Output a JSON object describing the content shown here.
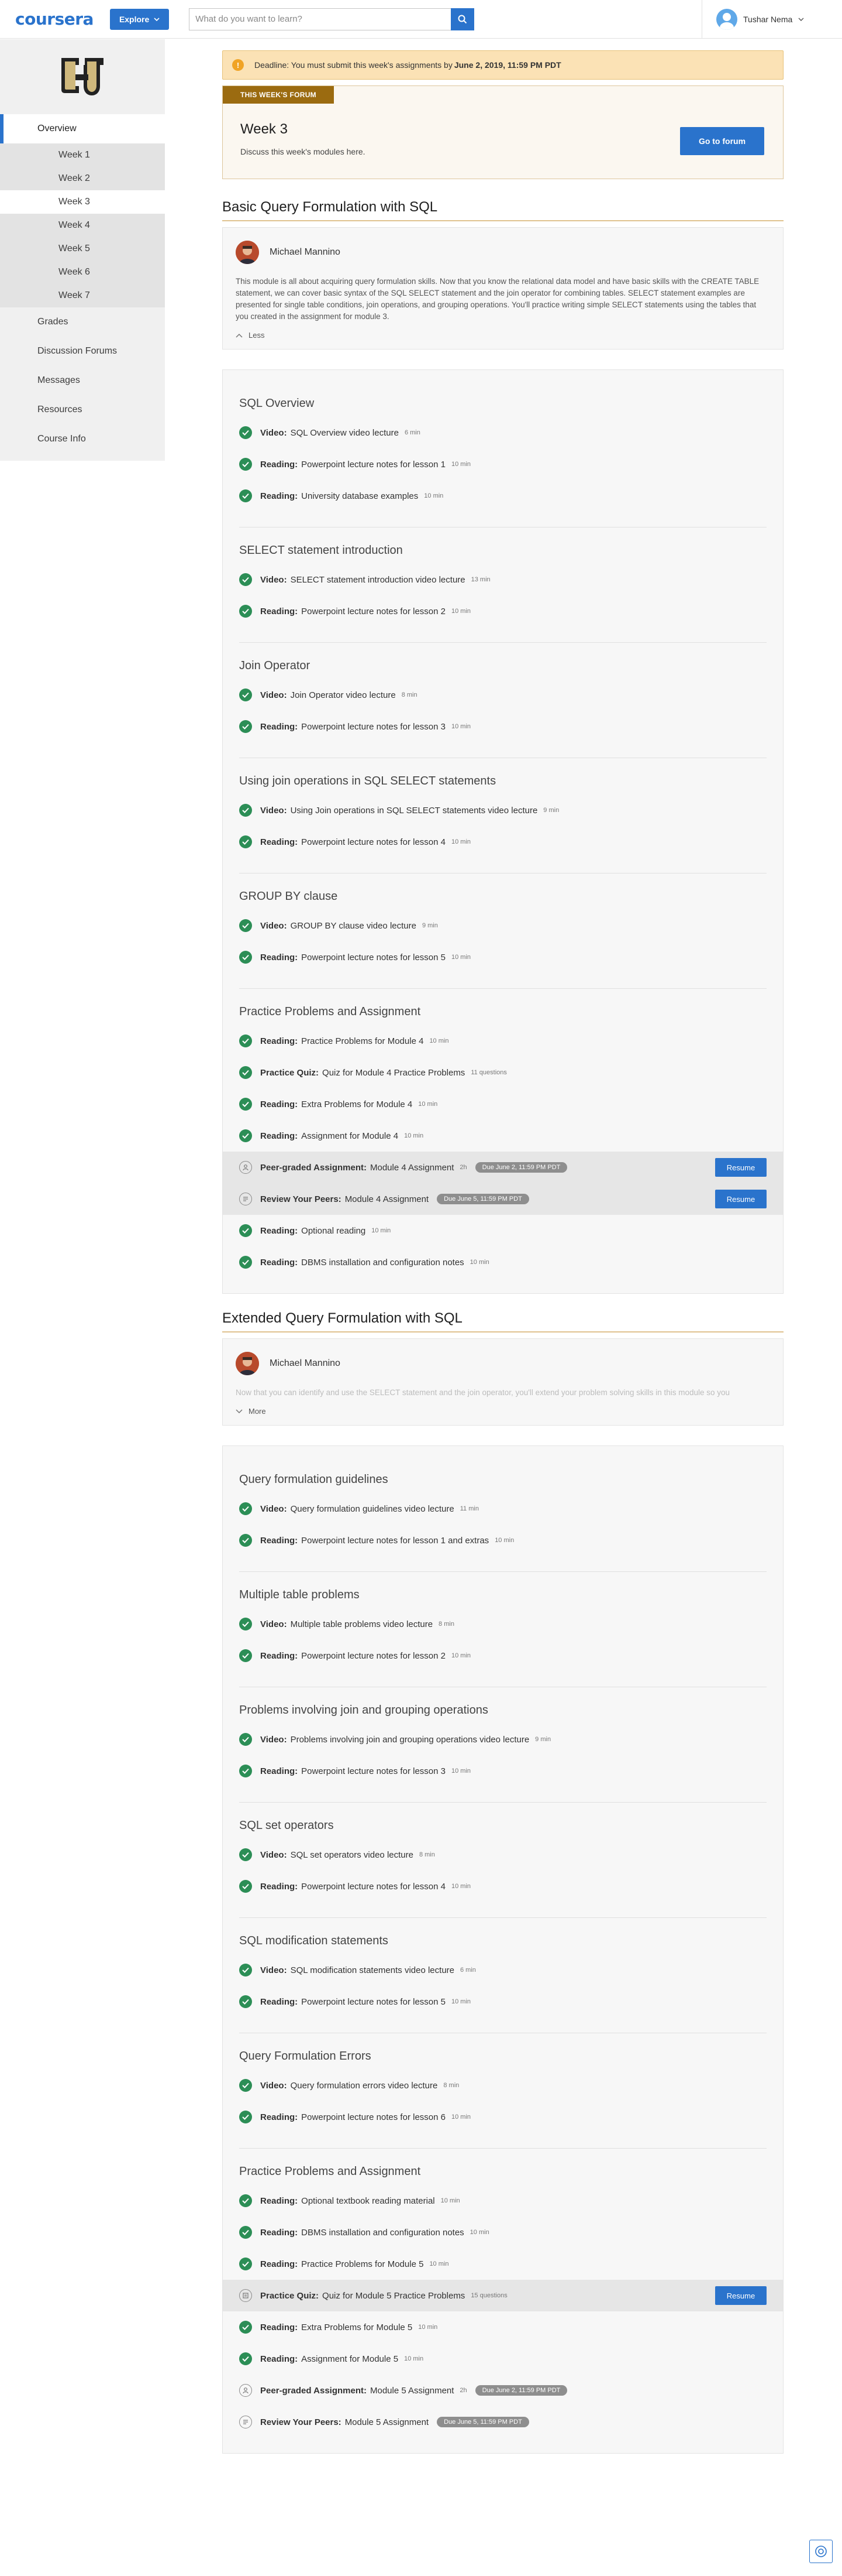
{
  "header": {
    "logo_text": "coursera",
    "explore_label": "Explore",
    "search_placeholder": "What do you want to learn?",
    "user_name": "Tushar Nema",
    "brand_color": "#2a73cc"
  },
  "sidebar": {
    "items": [
      {
        "label": "Overview"
      },
      {
        "label": "Week 1"
      },
      {
        "label": "Week 2"
      },
      {
        "label": "Week 3"
      },
      {
        "label": "Week 4"
      },
      {
        "label": "Week 5"
      },
      {
        "label": "Week 6"
      },
      {
        "label": "Week 7"
      },
      {
        "label": "Grades"
      },
      {
        "label": "Discussion Forums"
      },
      {
        "label": "Messages"
      },
      {
        "label": "Resources"
      },
      {
        "label": "Course Info"
      }
    ]
  },
  "deadline": {
    "prefix": "Deadline: You must submit this week's assignments by ",
    "date": "June 2, 2019, 11:59 PM PDT"
  },
  "forum": {
    "tag": "THIS WEEK'S FORUM",
    "title": "Week 3",
    "description": "Discuss this week's modules here.",
    "button_label": "Go to forum"
  },
  "modules": [
    {
      "title": "Basic Query Formulation with SQL",
      "instructor": "Michael Mannino",
      "description": "This module is all about acquiring query formulation skills. Now that you know the relational data model and have basic skills with the CREATE TABLE statement, we can cover basic syntax of the SQL SELECT statement and the join operator for combining tables. SELECT statement examples are presented for single table conditions, join operations, and grouping operations. You'll practice writing simple SELECT statements using the tables that you created in the assignment for module 3.",
      "toggle_label": "Less",
      "lessons": [
        {
          "title": "SQL Overview",
          "items": [
            {
              "type": "Video:",
              "name": "SQL Overview video lecture",
              "duration": "6 min"
            },
            {
              "type": "Reading:",
              "name": "Powerpoint lecture notes for lesson 1",
              "duration": "10 min"
            },
            {
              "type": "Reading:",
              "name": "University database examples",
              "duration": "10 min"
            }
          ]
        },
        {
          "title": "SELECT statement introduction",
          "items": [
            {
              "type": "Video:",
              "name": "SELECT statement introduction video lecture",
              "duration": "13 min"
            },
            {
              "type": "Reading:",
              "name": "Powerpoint lecture notes for lesson 2",
              "duration": "10 min"
            }
          ]
        },
        {
          "title": "Join Operator",
          "items": [
            {
              "type": "Video:",
              "name": "Join Operator video lecture",
              "duration": "8 min"
            },
            {
              "type": "Reading:",
              "name": "Powerpoint lecture notes for lesson 3",
              "duration": "10 min"
            }
          ]
        },
        {
          "title": "Using join operations in SQL SELECT statements",
          "items": [
            {
              "type": "Video:",
              "name": "Using Join operations in SQL SELECT statements video lecture",
              "duration": "9 min"
            },
            {
              "type": "Reading:",
              "name": "Powerpoint lecture notes for lesson 4",
              "duration": "10 min"
            }
          ]
        },
        {
          "title": "GROUP BY clause",
          "items": [
            {
              "type": "Video:",
              "name": "GROUP BY clause video lecture",
              "duration": "9 min"
            },
            {
              "type": "Reading:",
              "name": "Powerpoint lecture notes for lesson 5",
              "duration": "10 min"
            }
          ]
        },
        {
          "title": "Practice Problems and Assignment",
          "items": [
            {
              "type": "Reading:",
              "name": "Practice Problems for Module 4",
              "duration": "10 min"
            },
            {
              "type": "Practice Quiz:",
              "name": "Quiz for Module 4 Practice Problems",
              "duration": "11 questions"
            },
            {
              "type": "Reading:",
              "name": "Extra Problems for Module 4",
              "duration": "10 min"
            },
            {
              "type": "Reading:",
              "name": "Assignment for Module 4",
              "duration": "10 min"
            },
            {
              "type": "Peer-graded Assignment:",
              "name": "Module 4 Assignment",
              "duration": "2h",
              "due": "Due June 2, 11:59 PM PDT",
              "button": "Resume",
              "status": "pending-peer"
            },
            {
              "type": "Review Your Peers:",
              "name": "Module 4 Assignment",
              "duration": "",
              "due": "Due June 5, 11:59 PM PDT",
              "button": "Resume",
              "status": "pending-review"
            },
            {
              "type": "Reading:",
              "name": "Optional reading",
              "duration": "10 min"
            },
            {
              "type": "Reading:",
              "name": "DBMS installation and configuration notes",
              "duration": "10 min"
            }
          ]
        }
      ]
    },
    {
      "title": "Extended Query Formulation with SQL",
      "instructor": "Michael Mannino",
      "description": "Now that you can identify and use the SELECT statement and the join operator, you'll extend your problem solving skills in this module so you",
      "toggle_label": "More",
      "lessons": [
        {
          "title": "Query formulation guidelines",
          "items": [
            {
              "type": "Video:",
              "name": "Query formulation guidelines video lecture",
              "duration": "11 min"
            },
            {
              "type": "Reading:",
              "name": "Powerpoint lecture notes for lesson 1 and extras",
              "duration": "10 min"
            }
          ]
        },
        {
          "title": "Multiple table problems",
          "items": [
            {
              "type": "Video:",
              "name": "Multiple table problems video lecture",
              "duration": "8 min"
            },
            {
              "type": "Reading:",
              "name": "Powerpoint lecture notes for lesson 2",
              "duration": "10 min"
            }
          ]
        },
        {
          "title": "Problems involving join and grouping operations",
          "items": [
            {
              "type": "Video:",
              "name": "Problems involving join and grouping operations video lecture",
              "duration": "9 min"
            },
            {
              "type": "Reading:",
              "name": "Powerpoint lecture notes for lesson 3",
              "duration": "10 min"
            }
          ]
        },
        {
          "title": "SQL set operators",
          "items": [
            {
              "type": "Video:",
              "name": "SQL set operators video lecture",
              "duration": "8 min"
            },
            {
              "type": "Reading:",
              "name": "Powerpoint lecture notes for lesson 4",
              "duration": "10 min"
            }
          ]
        },
        {
          "title": "SQL modification statements",
          "items": [
            {
              "type": "Video:",
              "name": "SQL modification statements video lecture",
              "duration": "6 min"
            },
            {
              "type": "Reading:",
              "name": "Powerpoint lecture notes for lesson 5",
              "duration": "10 min"
            }
          ]
        },
        {
          "title": "Query Formulation Errors",
          "items": [
            {
              "type": "Video:",
              "name": "Query formulation errors video lecture",
              "duration": "8 min"
            },
            {
              "type": "Reading:",
              "name": "Powerpoint lecture notes for lesson 6",
              "duration": "10 min"
            }
          ]
        },
        {
          "title": "Practice Problems and Assignment",
          "items": [
            {
              "type": "Reading:",
              "name": "Optional textbook reading material",
              "duration": "10 min"
            },
            {
              "type": "Reading:",
              "name": "DBMS installation and configuration notes",
              "duration": "10 min"
            },
            {
              "type": "Reading:",
              "name": "Practice Problems for Module 5",
              "duration": "10 min"
            },
            {
              "type": "Practice Quiz:",
              "name": "Quiz for Module 5 Practice Problems",
              "duration": "15 questions",
              "button": "Resume",
              "status": "pending-quiz"
            },
            {
              "type": "Reading:",
              "name": "Extra Problems for Module 5",
              "duration": "10 min"
            },
            {
              "type": "Reading:",
              "name": "Assignment for Module 5",
              "duration": "10 min"
            },
            {
              "type": "Peer-graded Assignment:",
              "name": "Module 5 Assignment",
              "duration": "2h",
              "due": "Due June 2, 11:59 PM PDT",
              "status": "pending-peer"
            },
            {
              "type": "Review Your Peers:",
              "name": "Module 5 Assignment",
              "duration": "",
              "due": "Due June 5, 11:59 PM PDT",
              "status": "pending-review"
            }
          ]
        }
      ]
    }
  ],
  "colors": {
    "accent": "#2a73cc",
    "complete": "#2c8e56",
    "deadline_bg": "#fbe2b5",
    "forum_tag": "#9b6b10",
    "module_rule": "#e0c28f"
  }
}
